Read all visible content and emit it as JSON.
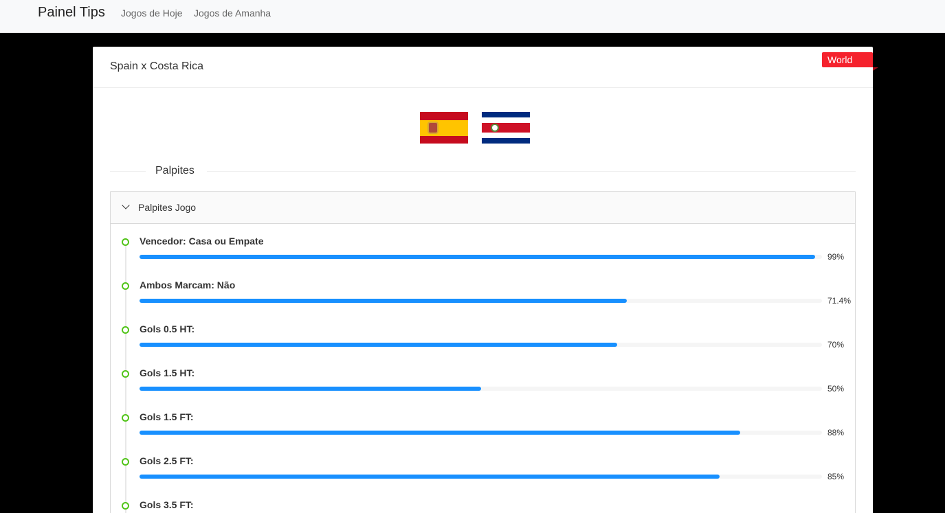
{
  "nav": {
    "brand": "Painel Tips",
    "links": [
      "Jogos de Hoje",
      "Jogos de Amanha"
    ]
  },
  "match": {
    "title": "Spain x Costa Rica",
    "competition": "World Cup",
    "flags": [
      "spain-flag-icon",
      "costa-rica-flag-icon"
    ]
  },
  "section_title": "Palpites",
  "panel": {
    "title": "Palpites Jogo",
    "tips": [
      {
        "label": "Vencedor: Casa ou Empate",
        "percent_text": "99%",
        "value": 99
      },
      {
        "label": "Ambos Marcam: Não",
        "percent_text": "71.4%",
        "value": 71.4
      },
      {
        "label": "Gols 0.5 HT:",
        "percent_text": "70%",
        "value": 70
      },
      {
        "label": "Gols 1.5 HT:",
        "percent_text": "50%",
        "value": 50
      },
      {
        "label": "Gols 1.5 FT:",
        "percent_text": "88%",
        "value": 88
      },
      {
        "label": "Gols 2.5 FT:",
        "percent_text": "85%",
        "value": 85
      },
      {
        "label": "Gols 3.5 FT:",
        "percent_text": "",
        "value": null
      }
    ]
  },
  "colors": {
    "progress": "#1890ff",
    "dot": "#52c41a",
    "ribbon": "#f5222d"
  }
}
